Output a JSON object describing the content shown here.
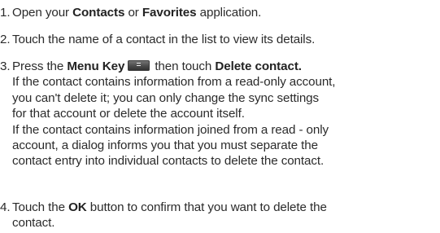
{
  "steps": [
    {
      "number": "1.",
      "text_pre": "Open your ",
      "bold1": "Contacts",
      "text_mid": " or ",
      "bold2": "Favorites",
      "text_post": " application."
    },
    {
      "number": "2.",
      "text": "Touch the name of a contact in the list to view its details."
    },
    {
      "number": "3.",
      "text_pre": "Press the ",
      "bold1": "Menu Key",
      "icon": "menu-key-icon",
      "text_mid": "then touch ",
      "bold2": "Delete contact.",
      "lines": [
        "If the contact contains information from a read-only account,",
        "you can't delete it; you can only change the sync settings",
        "for that account or delete the account itself.",
        "If the contact contains information joined from a read - only",
        "account, a dialog informs you that you must separate the",
        "contact entry into individual contacts to delete the contact."
      ]
    },
    {
      "number": "4.",
      "text_pre": "Touch the ",
      "bold1": "OK",
      "text_post": " button to confirm that you want to delete the",
      "line2": "contact."
    }
  ]
}
